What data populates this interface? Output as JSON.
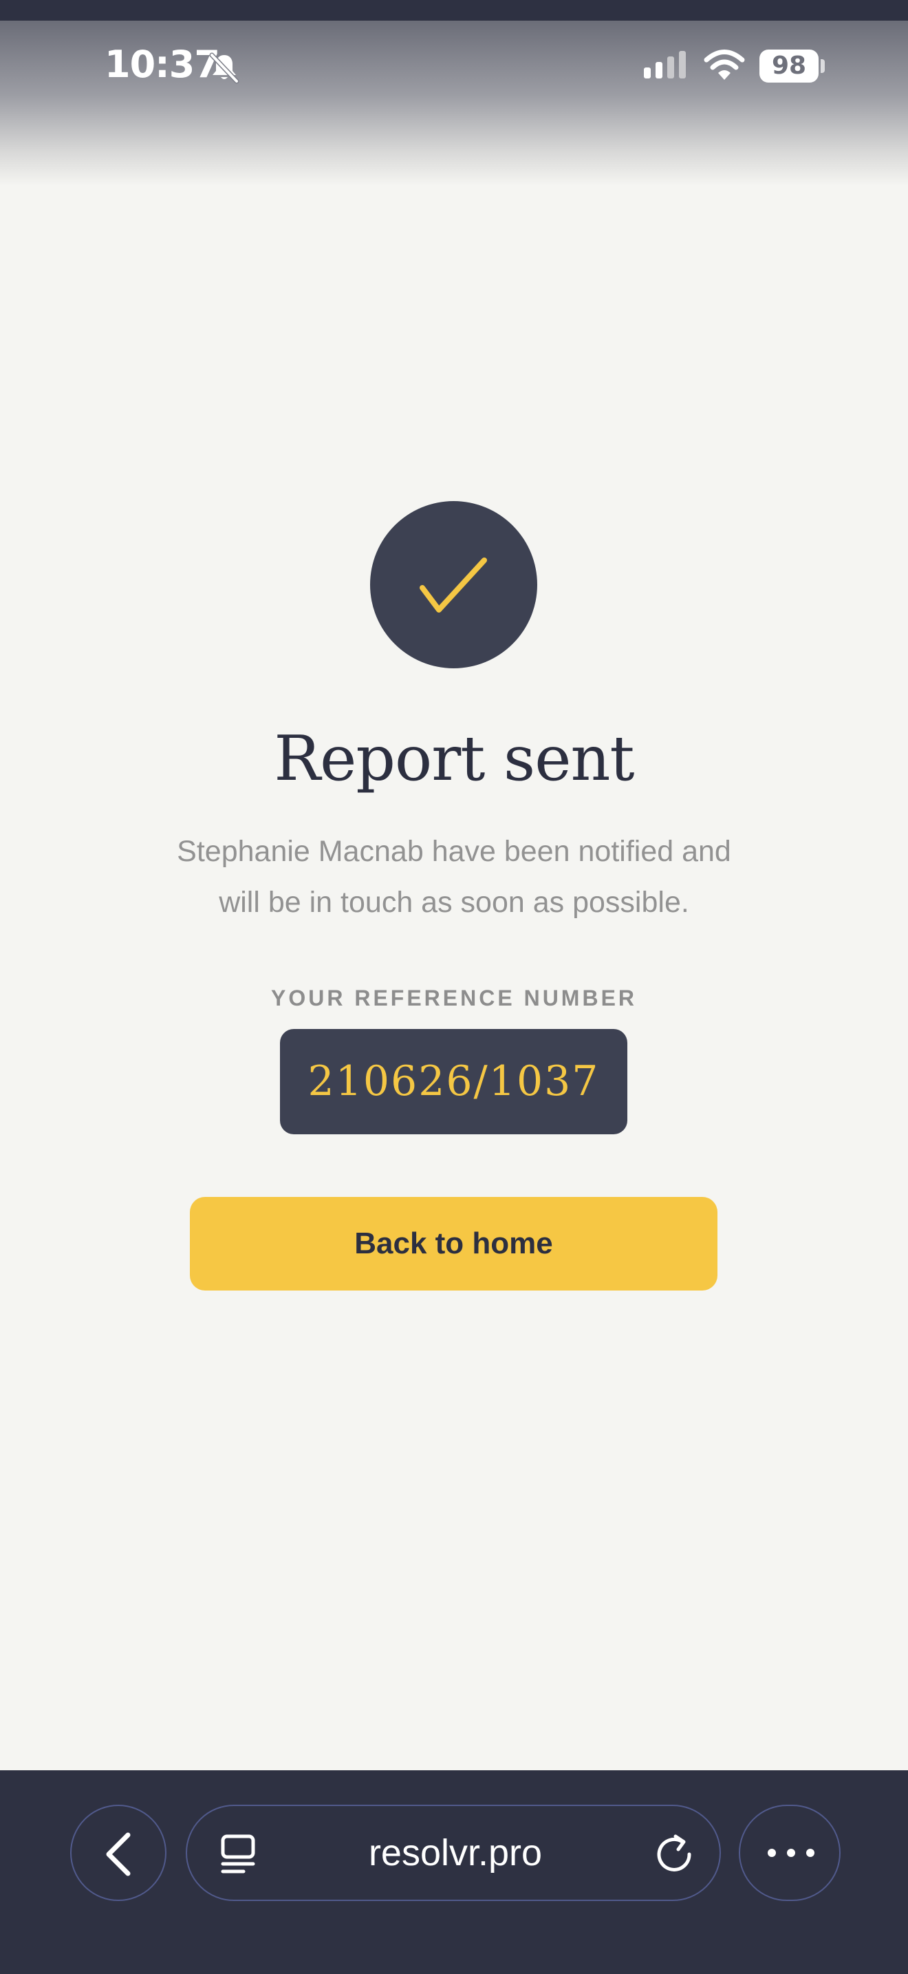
{
  "status_bar": {
    "time": "10:37",
    "battery": "98"
  },
  "confirmation": {
    "title": "Report sent",
    "message": "Stephanie Macnab have been notified and will be in touch as soon as possible.",
    "reference_label": "YOUR REFERENCE NUMBER",
    "reference_number": "210626/1037",
    "home_button_label": "Back to home"
  },
  "browser": {
    "url": "resolvr.pro"
  },
  "colors": {
    "accent": "#f6c744",
    "dark": "#3d4152",
    "background": "#f5f5f2",
    "browser_bar": "#2e3142"
  },
  "icons": {
    "status": [
      "bell-slash-icon",
      "cellular-signal-icon",
      "wifi-icon",
      "battery-icon"
    ],
    "main": "checkmark-icon",
    "browser": [
      "back-arrow-icon",
      "tabs-icon",
      "reload-icon",
      "more-icon"
    ]
  }
}
